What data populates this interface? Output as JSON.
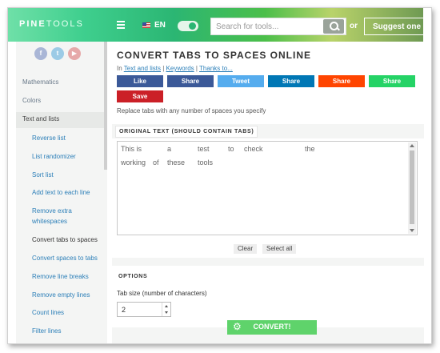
{
  "header": {
    "logo_bold": "PINE",
    "logo_light": "TOOLS",
    "language": "EN",
    "search_placeholder": "Search for tools...",
    "or_text": "or",
    "suggest_label": "Suggest one"
  },
  "sidebar": {
    "social": [
      "f",
      "t",
      "▶"
    ],
    "categories": [
      "Mathematics",
      "Colors",
      "Text and lists"
    ],
    "items": [
      "Reverse list",
      "List randomizer",
      "Sort list",
      "Add text to each line",
      "Remove extra whitespaces",
      "Convert tabs to spaces",
      "Convert spaces to tabs",
      "Remove line breaks",
      "Remove empty lines",
      "Count lines",
      "Filter lines"
    ]
  },
  "main": {
    "title": "CONVERT TABS TO SPACES ONLINE",
    "crumb_in": "In",
    "crumb_category": "Text and lists",
    "crumb_keywords": "Keywords",
    "crumb_thanks": "Thanks to...",
    "share": [
      {
        "label": "Like",
        "color": "#3b5998"
      },
      {
        "label": "Share",
        "color": "#3b5998"
      },
      {
        "label": "Tweet",
        "color": "#55acee"
      },
      {
        "label": "Share",
        "color": "#0077b5"
      },
      {
        "label": "Share",
        "color": "#ff4500"
      },
      {
        "label": "Share",
        "color": "#25d366"
      },
      {
        "label": "Save",
        "color": "#cb2027"
      }
    ],
    "description": "Replace tabs with any number of spaces you specify",
    "original_label": "ORIGINAL TEXT (SHOULD CONTAIN TABS)",
    "text_line1": "This is\ta\ttest\tto\tcheck\t\tthe",
    "text_line2": "working\tof\tthese\ttools",
    "clear_label": "Clear",
    "select_all_label": "Select all",
    "options_label": "OPTIONS",
    "tab_size_label": "Tab size (number of characters)",
    "tab_size_value": "2",
    "convert_label": "CONVERT!"
  }
}
